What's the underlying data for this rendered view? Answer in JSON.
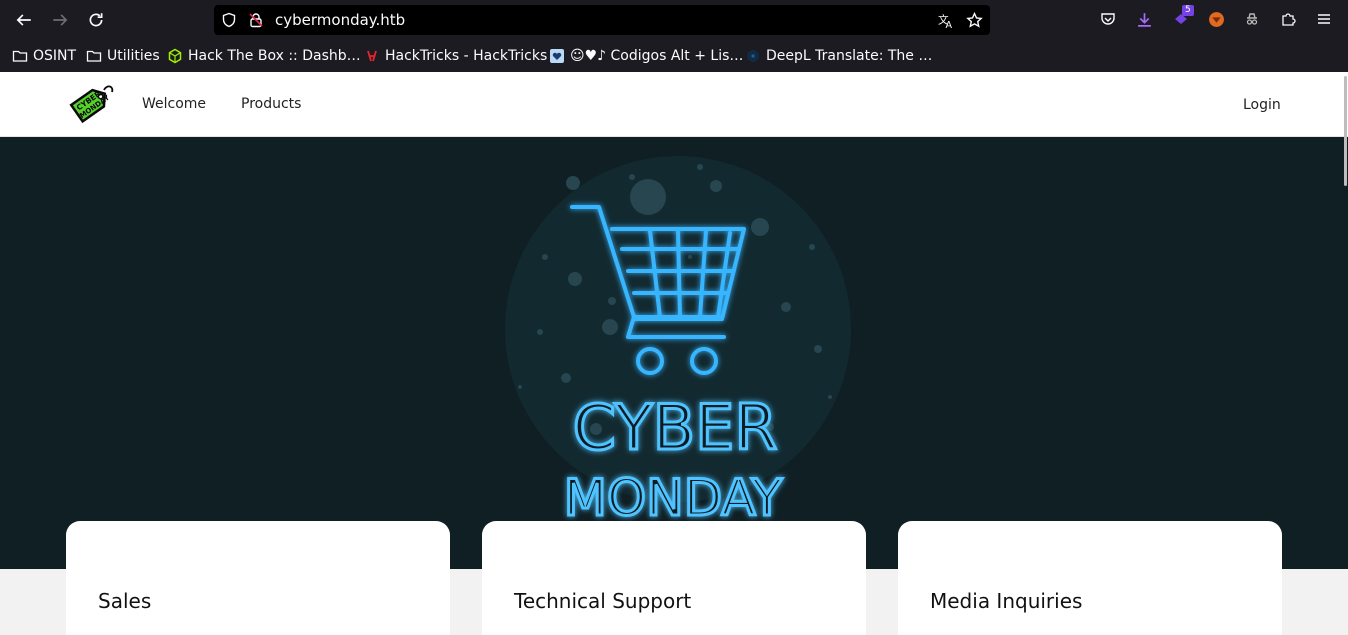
{
  "browser": {
    "url": "cybermonday.htb",
    "extension_badge": "5",
    "bookmarks": [
      {
        "label": "OSINT",
        "icon": "folder-icon"
      },
      {
        "label": "Utilities",
        "icon": "folder-icon"
      },
      {
        "label": "Hack The Box :: Dashb…",
        "icon": "hackthebox-icon"
      },
      {
        "label": "HackTricks - HackTricks",
        "icon": "hacktricks-icon"
      },
      {
        "label": "☺♥♪ Codigos Alt + Lis…",
        "icon": "heart-icon"
      },
      {
        "label": "DeepL Translate: The …",
        "icon": "deepl-icon"
      }
    ]
  },
  "site": {
    "nav": {
      "welcome": "Welcome",
      "products": "Products",
      "login": "Login"
    },
    "logo_text": [
      "CYBER",
      "MONDAY"
    ],
    "hero": {
      "line1": "CYBER",
      "line2": "MONDAY"
    },
    "cards": [
      {
        "title": "Sales"
      },
      {
        "title": "Technical Support"
      },
      {
        "title": "Media Inquiries"
      }
    ]
  },
  "colors": {
    "chrome_bg": "#1c1b22",
    "hero_bg": "#0f1f24",
    "neon_blue": "#3fb8ff",
    "logo_green": "#56d12b"
  }
}
